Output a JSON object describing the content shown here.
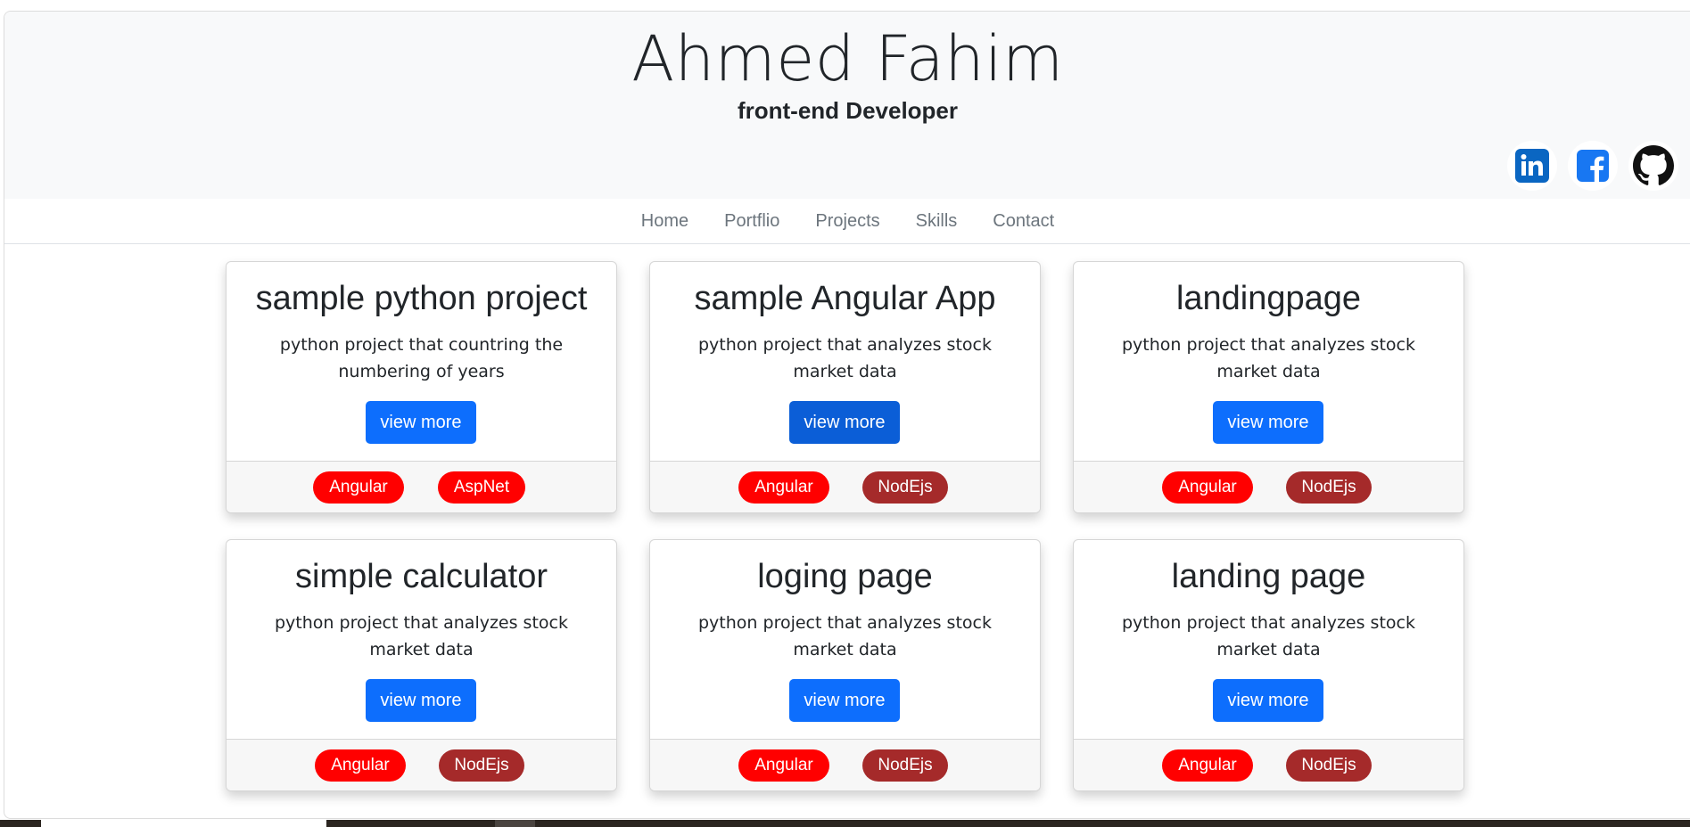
{
  "header": {
    "name": "Ahmed Fahim",
    "role": "front-end Developer",
    "social": [
      {
        "icon": "linkedin-icon",
        "color": "#0a66c2"
      },
      {
        "icon": "facebook-icon",
        "color": "#1877f2"
      },
      {
        "icon": "github-icon",
        "color": "#111111"
      }
    ]
  },
  "nav": {
    "items": [
      "Home",
      "Portflio",
      "Projects",
      "Skills",
      "Contact"
    ]
  },
  "colors": {
    "primary": "#0d6efd",
    "badge_angular": "#ff0000",
    "badge_secondary": "#a52a2a"
  },
  "cards": [
    {
      "title": "sample python project",
      "text": "python project that countring the numbering of years",
      "button": "view more",
      "tags": [
        "Angular",
        "AspNet"
      ]
    },
    {
      "title": "sample Angular App",
      "text": "python project that analyzes stock market data",
      "button": "view more",
      "tags": [
        "Angular",
        "NodEjs"
      ]
    },
    {
      "title": "landingpage",
      "text": "python project that analyzes stock market data",
      "button": "view more",
      "tags": [
        "Angular",
        "NodEjs"
      ]
    },
    {
      "title": "simple calculator",
      "text": "python project that analyzes stock market data",
      "button": "view more",
      "tags": [
        "Angular",
        "NodEjs"
      ]
    },
    {
      "title": "loging page",
      "text": "python project that analyzes stock market data",
      "button": "view more",
      "tags": [
        "Angular",
        "NodEjs"
      ]
    },
    {
      "title": "landing page",
      "text": "python project that analyzes stock market data",
      "button": "view more",
      "tags": [
        "Angular",
        "NodEjs"
      ]
    }
  ]
}
